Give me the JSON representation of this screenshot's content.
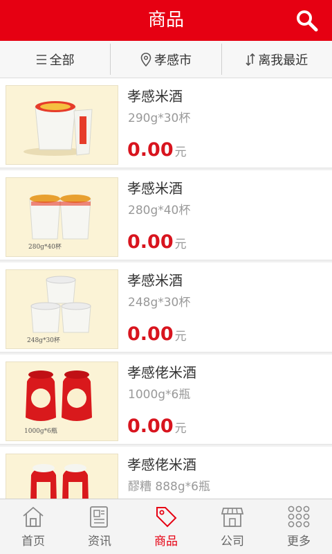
{
  "header": {
    "title": "商品"
  },
  "filters": [
    {
      "label": "全部",
      "icon": "menu-icon"
    },
    {
      "label": "孝感市",
      "icon": "location-pin-icon"
    },
    {
      "label": "离我最近",
      "icon": "sort-icon"
    }
  ],
  "products": [
    {
      "name": "孝感米酒",
      "spec": "290g*30杯",
      "price": "0.00",
      "unit": "元",
      "thumb_caption": ""
    },
    {
      "name": "孝感米酒",
      "spec": "280g*40杯",
      "price": "0.00",
      "unit": "元",
      "thumb_caption": "280g*40杯"
    },
    {
      "name": "孝感米酒",
      "spec": "248g*30杯",
      "price": "0.00",
      "unit": "元",
      "thumb_caption": "248g*30杯"
    },
    {
      "name": "孝感佬米酒",
      "spec": "1000g*6瓶",
      "price": "0.00",
      "unit": "元",
      "thumb_caption": "1000g*6瓶"
    },
    {
      "name": "孝感佬米酒",
      "spec": "醪糟 888g*6瓶",
      "price": "",
      "unit": "",
      "thumb_caption": ""
    }
  ],
  "tabs": [
    {
      "label": "首页",
      "icon": "home-icon",
      "active": false
    },
    {
      "label": "资讯",
      "icon": "news-icon",
      "active": false
    },
    {
      "label": "商品",
      "icon": "tag-icon",
      "active": true
    },
    {
      "label": "公司",
      "icon": "store-icon",
      "active": false
    },
    {
      "label": "更多",
      "icon": "grid-dots-icon",
      "active": false
    }
  ],
  "colors": {
    "brand_red": "#e60012",
    "price_red": "#d8141e"
  }
}
